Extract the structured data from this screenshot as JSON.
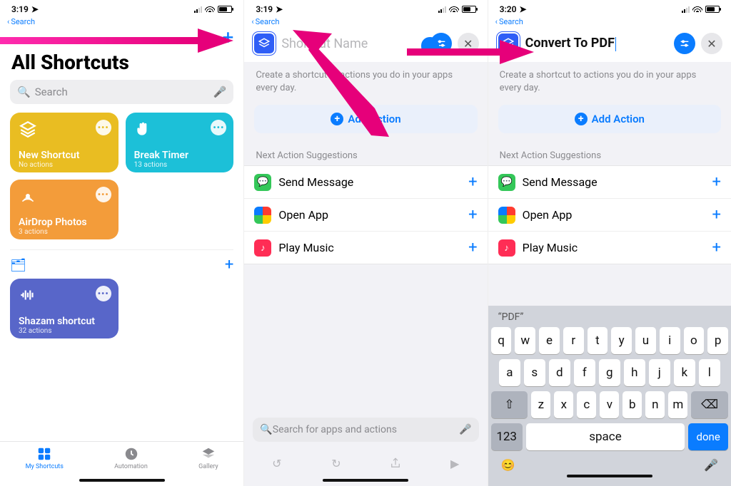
{
  "status": {
    "time1": "3:19",
    "time2": "3:19",
    "time3": "3:20",
    "back": "Search"
  },
  "panel1": {
    "title": "All Shortcuts",
    "search_placeholder": "Search",
    "tiles": [
      {
        "title": "New Shortcut",
        "sub": "No actions"
      },
      {
        "title": "Break Timer",
        "sub": "13 actions"
      },
      {
        "title": "AirDrop Photos",
        "sub": "3 actions"
      },
      {
        "title": "Shazam shortcut",
        "sub": "32 actions"
      }
    ],
    "tabs": {
      "my": "My Shortcuts",
      "auto": "Automation",
      "gallery": "Gallery"
    }
  },
  "editor": {
    "placeholder_name": "Shortcut Name",
    "typed_name": "Convert To PDF",
    "helper": "Create a shortcut to actions you do in your apps every day.",
    "add_action": "Add Action",
    "nas_title": "Next Action Suggestions",
    "nas": [
      {
        "label": "Send Message"
      },
      {
        "label": "Open App"
      },
      {
        "label": "Play Music"
      }
    ],
    "search2_placeholder": "Search for apps and actions"
  },
  "keyboard": {
    "suggestion": "“PDF”",
    "row1": [
      "q",
      "w",
      "e",
      "r",
      "t",
      "y",
      "u",
      "i",
      "o",
      "p"
    ],
    "row2": [
      "a",
      "s",
      "d",
      "f",
      "g",
      "h",
      "j",
      "k",
      "l"
    ],
    "row3": [
      "z",
      "x",
      "c",
      "v",
      "b",
      "n",
      "m"
    ],
    "num": "123",
    "space": "space",
    "done": "done"
  }
}
